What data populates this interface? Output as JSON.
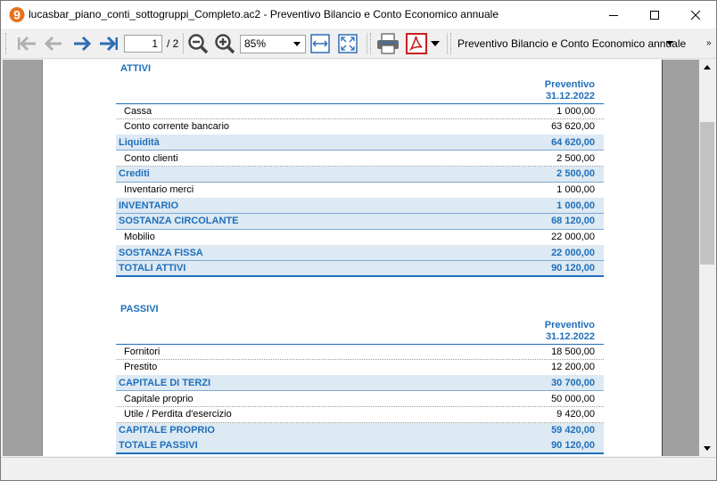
{
  "window": {
    "title": "lucasbar_piano_conti_sottogruppi_Completo.ac2 - Preventivo Bilancio e Conto Economico annuale",
    "app_logo_glyph": "9",
    "accent": "#1f6fba"
  },
  "toolbar": {
    "page_current": "1",
    "page_total": "/ 2",
    "zoom": "85%",
    "report": "Preventivo Bilancio e Conto Economico annuale",
    "more": "»"
  },
  "attivi": {
    "title": "ATTIVI",
    "col_head_1": "Preventivo",
    "col_head_2": "31.12.2022",
    "rows": [
      {
        "desc": "Cassa",
        "amount": "1 000,00"
      },
      {
        "desc": "Conto corrente bancario",
        "amount": "63 620,00"
      },
      {
        "desc": "Liquidità",
        "amount": "64 620,00"
      },
      {
        "desc": "Conto clienti",
        "amount": "2 500,00"
      },
      {
        "desc": "Crediti",
        "amount": "2 500,00"
      },
      {
        "desc": "Inventario merci",
        "amount": "1 000,00"
      },
      {
        "desc": "INVENTARIO",
        "amount": "1 000,00"
      },
      {
        "desc": "SOSTANZA CIRCOLANTE",
        "amount": "68 120,00"
      },
      {
        "desc": "Mobilio",
        "amount": "22 000,00"
      },
      {
        "desc": "SOSTANZA FISSA",
        "amount": "22 000,00"
      },
      {
        "desc": "TOTALI ATTIVI",
        "amount": "90 120,00"
      }
    ]
  },
  "passivi": {
    "title": "PASSIVI",
    "col_head_1": "Preventivo",
    "col_head_2": "31.12.2022",
    "rows": [
      {
        "desc": "Fornitori",
        "amount": "18 500,00"
      },
      {
        "desc": "Prestito",
        "amount": "12 200,00"
      },
      {
        "desc": "CAPITALE DI TERZI",
        "amount": "30 700,00"
      },
      {
        "desc": "Capitale proprio",
        "amount": "50 000,00"
      },
      {
        "desc": "Utile / Perdita d'esercizio",
        "amount": "9 420,00"
      },
      {
        "desc": "CAPITALE PROPRIO",
        "amount": "59 420,00"
      },
      {
        "desc": "TOTALE PASSIVI",
        "amount": "90 120,00"
      }
    ]
  },
  "icons": {
    "nav_first": "first-page-icon",
    "nav_prev": "previous-page-icon",
    "nav_next": "next-page-icon",
    "nav_last": "last-page-icon",
    "zoom_out": "zoom-out-icon",
    "zoom_in": "zoom-in-icon",
    "fit_width": "fit-width-icon",
    "fit_page": "fit-page-icon",
    "print": "printer-icon",
    "pdf": "pdf-icon"
  }
}
